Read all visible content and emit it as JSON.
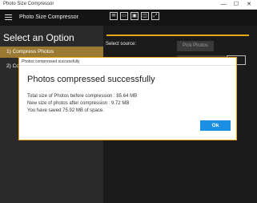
{
  "window": {
    "title": "Photo Size Compressor",
    "minimize": "—",
    "maximize": "☐",
    "close": "✕"
  },
  "header": {
    "app_title": "Photo Size Compressor",
    "toolbar_icons": [
      "mail-icon",
      "chat-icon",
      "photo-icon",
      "image-icon",
      "expand-icon"
    ]
  },
  "nav": {
    "heading": "Select an Option",
    "items": [
      {
        "label": "1) Compress Photos",
        "selected": true
      },
      {
        "label": "2) Co"
      }
    ]
  },
  "content": {
    "select_source_label": "Select source:",
    "pick_photos_label": "Pick Photos",
    "combo_arrow": "▾"
  },
  "dialog": {
    "window_title": "Photos compressed successfully",
    "heading": "Photos compressed successfully",
    "lines": [
      "Total size of Photos before compression : 85.64 MB",
      "New size of photos after compression : 9.72 MB",
      "You have saved 75.92 MB of space."
    ],
    "ok_label": "Ok"
  },
  "colors": {
    "accent": "#e6a817",
    "selected_nav": "#9a7a33",
    "ok_button": "#1a8fe3"
  }
}
